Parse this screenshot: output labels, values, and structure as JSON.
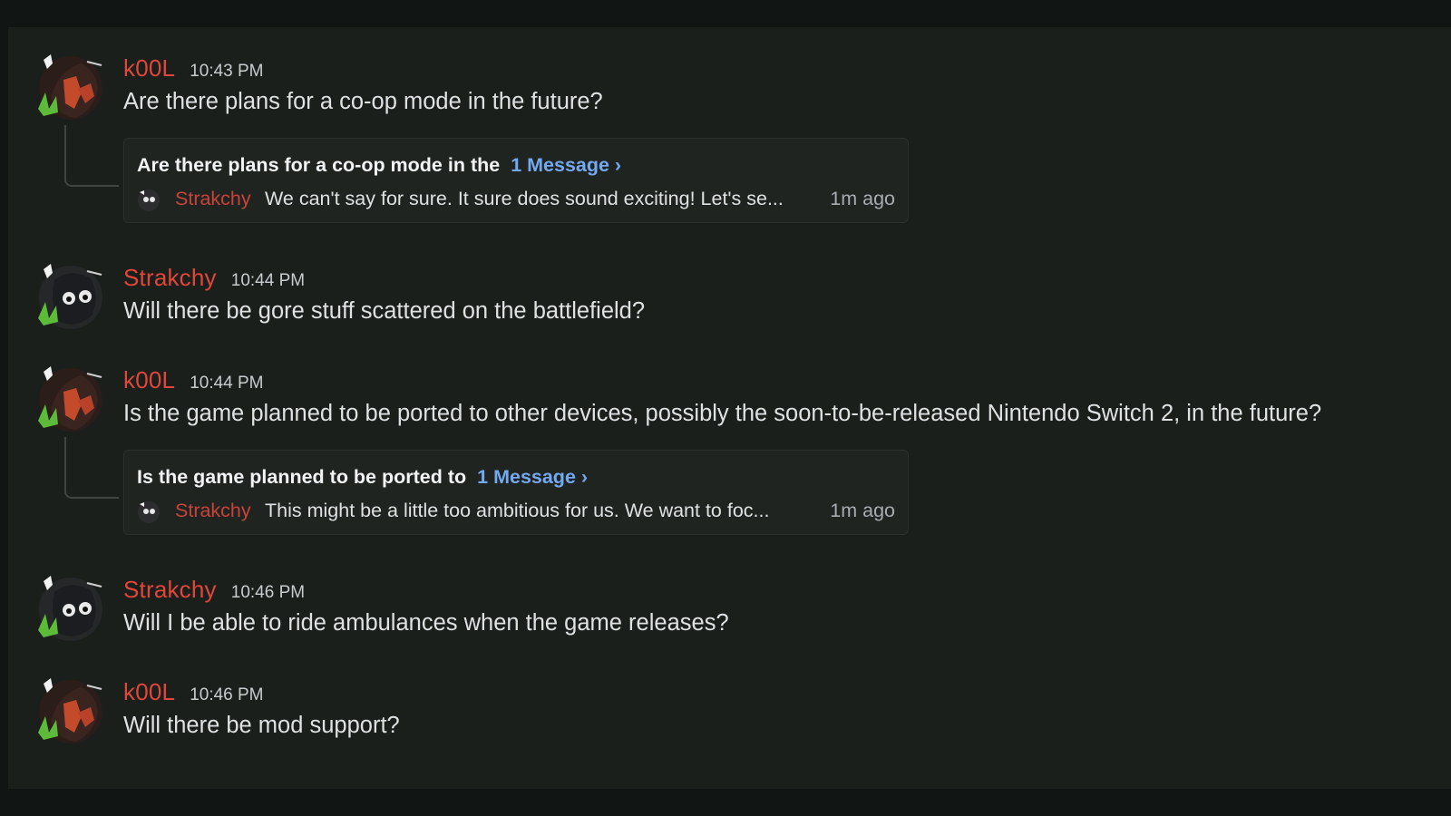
{
  "messages": [
    {
      "author": "k00L",
      "time": "10:43 PM",
      "text": "Are there plans for a co-op mode in the future?",
      "thread": {
        "title": "Are there plans for a co-op mode in the",
        "count": "1 Message ›",
        "author": "Strakchy",
        "preview": "We can't say for sure. It sure does sound exciting! Let's se...",
        "ago": "1m ago"
      }
    },
    {
      "author": "Strakchy",
      "time": "10:44 PM",
      "text": "Will there be gore stuff scattered on the battlefield?"
    },
    {
      "author": "k00L",
      "time": "10:44 PM",
      "text": "Is the game planned to be ported to other devices, possibly the soon-to-be-released Nintendo Switch 2, in the future?",
      "thread": {
        "title": "Is the game planned to be ported to",
        "count": "1 Message ›",
        "author": "Strakchy",
        "preview": "This might be a little too ambitious for us. We want to foc...",
        "ago": "1m ago"
      }
    },
    {
      "author": "Strakchy",
      "time": "10:46 PM",
      "text": "Will I be able to ride ambulances when the game releases?"
    },
    {
      "author": "k00L",
      "time": "10:46 PM",
      "text": "Will there be mod support?"
    }
  ],
  "colors": {
    "background": "#111614",
    "author": "#e0463a",
    "link": "#73a9f0"
  },
  "icons": {
    "k00l_avatar": "k00l-avatar-icon",
    "strakchy_avatar": "strakchy-avatar-icon"
  }
}
